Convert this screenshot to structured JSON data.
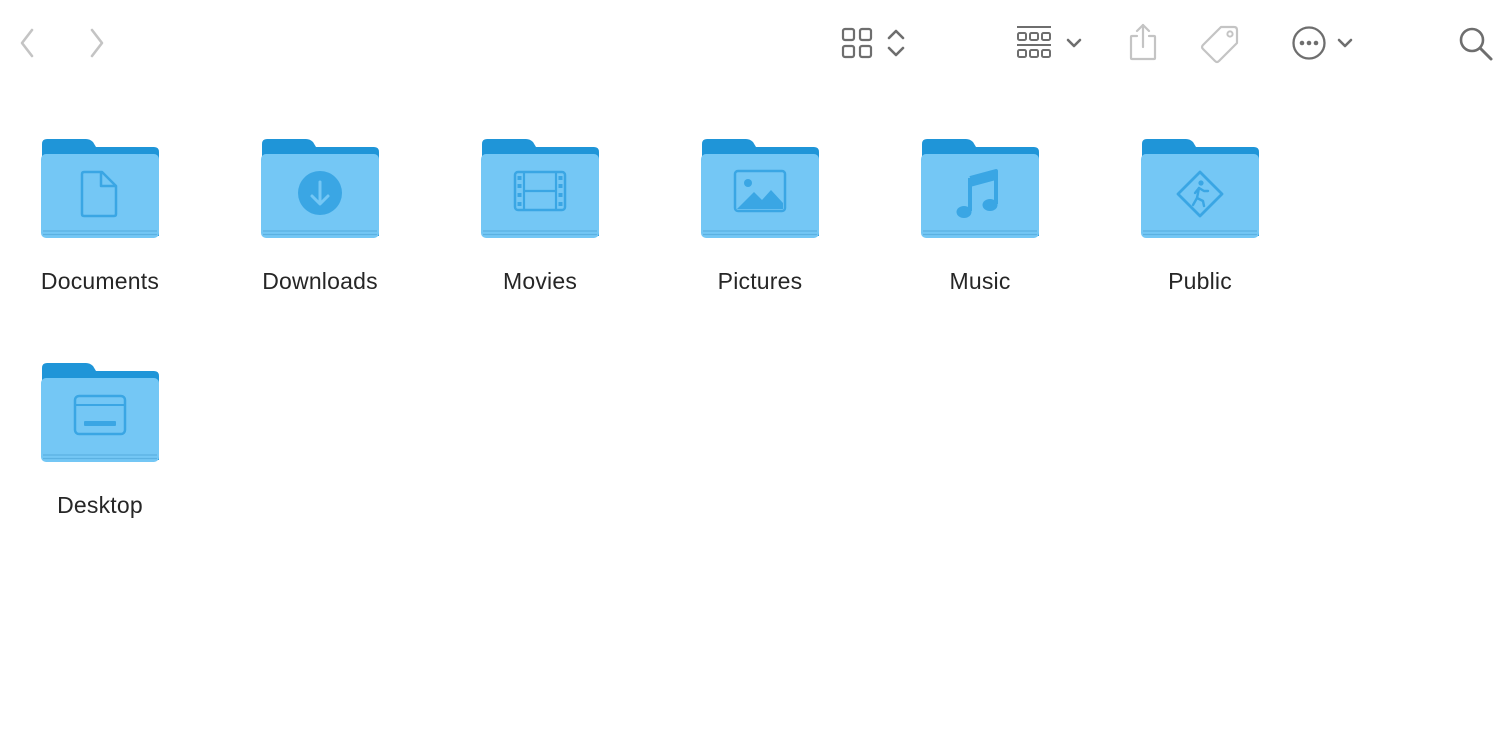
{
  "toolbar": {
    "back": {
      "icon": "chevron-left-icon",
      "enabled": false
    },
    "forward": {
      "icon": "chevron-right-icon",
      "enabled": false
    },
    "view_mode": {
      "icon": "icon-grid-icon"
    },
    "group_by": {
      "icon": "group-grid-icon"
    },
    "share": {
      "icon": "share-icon",
      "enabled": false
    },
    "tags": {
      "icon": "tag-icon",
      "enabled": false
    },
    "more": {
      "icon": "ellipsis-circle-icon"
    },
    "search": {
      "icon": "search-icon"
    }
  },
  "colors": {
    "folder_body": "#74c7f5",
    "folder_back": "#1f95d8",
    "folder_symbol": "#3aa6e4",
    "toolbar_icon": "#6e6e6e",
    "toolbar_icon_disabled": "#c4c4c4",
    "label": "#262626"
  },
  "items": [
    {
      "name": "Documents",
      "symbol": "document-icon"
    },
    {
      "name": "Downloads",
      "symbol": "download-icon"
    },
    {
      "name": "Movies",
      "symbol": "film-icon"
    },
    {
      "name": "Pictures",
      "symbol": "photo-icon"
    },
    {
      "name": "Music",
      "symbol": "music-note-icon"
    },
    {
      "name": "Public",
      "symbol": "public-sign-icon"
    },
    {
      "name": "Desktop",
      "symbol": "desktop-icon"
    }
  ]
}
